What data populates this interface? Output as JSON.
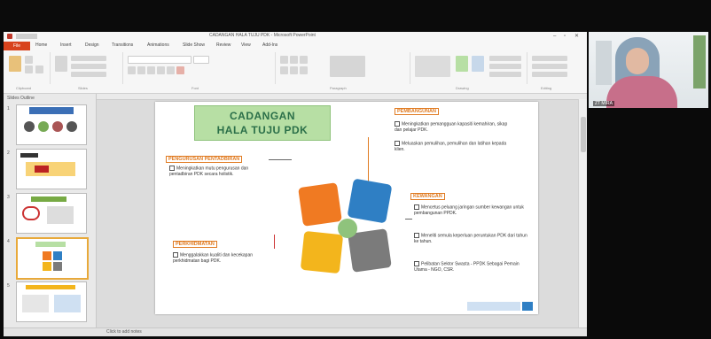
{
  "powerpoint": {
    "window_title": "CADANGAN HALA TUJU PDK - Microsoft PowerPoint",
    "file_tab": "File",
    "tabs": [
      "Home",
      "Insert",
      "Design",
      "Transitions",
      "Animations",
      "Slide Show",
      "Review",
      "View",
      "Add-Ins"
    ],
    "ribbon_groups": [
      "Clipboard",
      "Slides",
      "Font",
      "Paragraph",
      "Drawing",
      "Editing"
    ],
    "pane_tabs": "Slides  Outline",
    "slide_numbers": [
      "1",
      "2",
      "3",
      "4",
      "5"
    ],
    "status": "Click to add notes"
  },
  "slide": {
    "title_line1": "CADANGAN",
    "title_line2": "HALA TUJU PDK",
    "sections": {
      "pengurusan": {
        "heading": "PENGURUSAN PENTADBIRAN",
        "items": [
          "Meningkatkan mutu pengurusan dan pentadbiran PDK secara holistik."
        ]
      },
      "pembangunan": {
        "heading": "PEMBANGUNAN",
        "items": [
          "Meningkatkan pemangguan kapasiti kemahiran, sikap dan pelajar PDK.",
          "Meluaskan pemulihan, pemulihan dan latihan kepada klien."
        ]
      },
      "kewangan": {
        "heading": "KEWANGAN",
        "items": [
          "Mencetus peluang jaringan sumber kewangan untuk pembangunan PPDK.",
          "Meneliti semula keperluan peruntukan PDK dari tahun ke tahun.",
          "Pelibatan Sektor Swasta - PPDK Sebagai Pemain Utama - NGO, CSR."
        ]
      },
      "perkhidmatan": {
        "heading": "PERKHIDMATAN",
        "items": [
          "Menggalakkan kualiti dan kecekapan perkhidmatan bagi PDK."
        ]
      }
    }
  },
  "webcam": {
    "participant_label": "ZT MIRA"
  },
  "colors": {
    "accent": "#d8431d",
    "title_green": "#2b6f49",
    "puzzle_orange": "#f07a22",
    "puzzle_blue": "#2f7fc4",
    "puzzle_yellow": "#f3b51c",
    "puzzle_grey": "#7b7b7b",
    "puzzle_center": "#8fc37c"
  }
}
